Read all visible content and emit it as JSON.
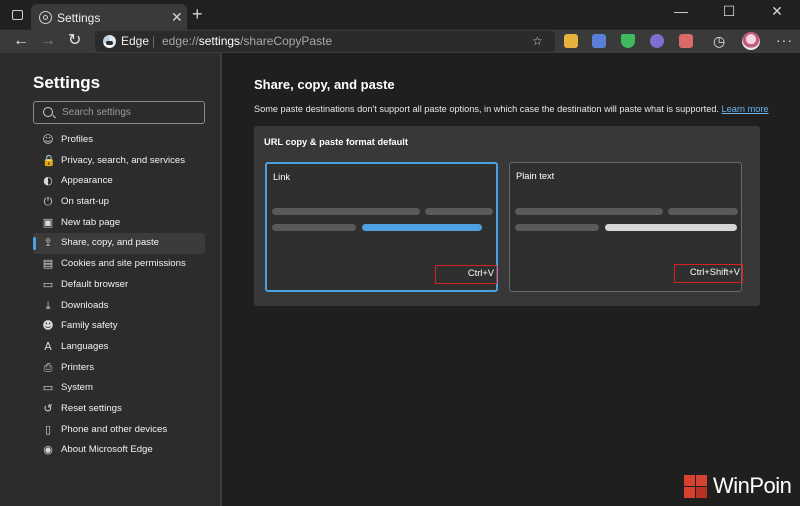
{
  "browser": {
    "tab_title": "Settings",
    "tab_close": "✕",
    "new_tab": "+",
    "window_controls": [
      "—",
      "☐",
      "✕"
    ],
    "omnibox_site": "Edge",
    "omnibox_separator": "|",
    "omnibox_url_prefix": "edge://",
    "omnibox_url_bold": "settings",
    "omnibox_url_suffix": "/shareCopyPaste",
    "back": "←",
    "forward": "→",
    "refresh": "↻",
    "more": "···",
    "extension_colors": [
      "#e9b23d",
      "#5a7fd6",
      "#3dbb5d",
      "#a8a8f0",
      "#d96a6a"
    ]
  },
  "sidebar": {
    "title": "Settings",
    "search_placeholder": "Search settings",
    "items": [
      {
        "label": "Profiles",
        "icon": "person-icon",
        "glyph": "☺"
      },
      {
        "label": "Privacy, search, and services",
        "icon": "lock-icon",
        "glyph": "🔒"
      },
      {
        "label": "Appearance",
        "icon": "palette-icon",
        "glyph": "◐"
      },
      {
        "label": "On start-up",
        "icon": "power-icon",
        "glyph": "⏻"
      },
      {
        "label": "New tab page",
        "icon": "new-tab-icon",
        "glyph": "▣"
      },
      {
        "label": "Share, copy, and paste",
        "icon": "share-icon",
        "glyph": "⇪",
        "active": true
      },
      {
        "label": "Cookies and site permissions",
        "icon": "cookie-icon",
        "glyph": "▤"
      },
      {
        "label": "Default browser",
        "icon": "browser-icon",
        "glyph": "▭"
      },
      {
        "label": "Downloads",
        "icon": "download-icon",
        "glyph": "⤓"
      },
      {
        "label": "Family safety",
        "icon": "family-icon",
        "glyph": "☻"
      },
      {
        "label": "Languages",
        "icon": "language-icon",
        "glyph": "A"
      },
      {
        "label": "Printers",
        "icon": "printer-icon",
        "glyph": "⎙"
      },
      {
        "label": "System",
        "icon": "system-icon",
        "glyph": "▭"
      },
      {
        "label": "Reset settings",
        "icon": "reset-icon",
        "glyph": "↺"
      },
      {
        "label": "Phone and other devices",
        "icon": "phone-icon",
        "glyph": "▯"
      },
      {
        "label": "About Microsoft Edge",
        "icon": "edge-icon",
        "glyph": "◉"
      }
    ]
  },
  "main": {
    "title": "Share, copy, and paste",
    "description": "Some paste destinations don't support all paste options, in which case the destination will paste what is supported.",
    "learn_more": "Learn more",
    "card_title": "URL copy & paste format default",
    "options": [
      {
        "label": "Link",
        "shortcut": "Ctrl+V",
        "selected": true
      },
      {
        "label": "Plain text",
        "shortcut": "Ctrl+Shift+V",
        "selected": false
      }
    ]
  },
  "watermark": {
    "text": "WinPoin"
  }
}
